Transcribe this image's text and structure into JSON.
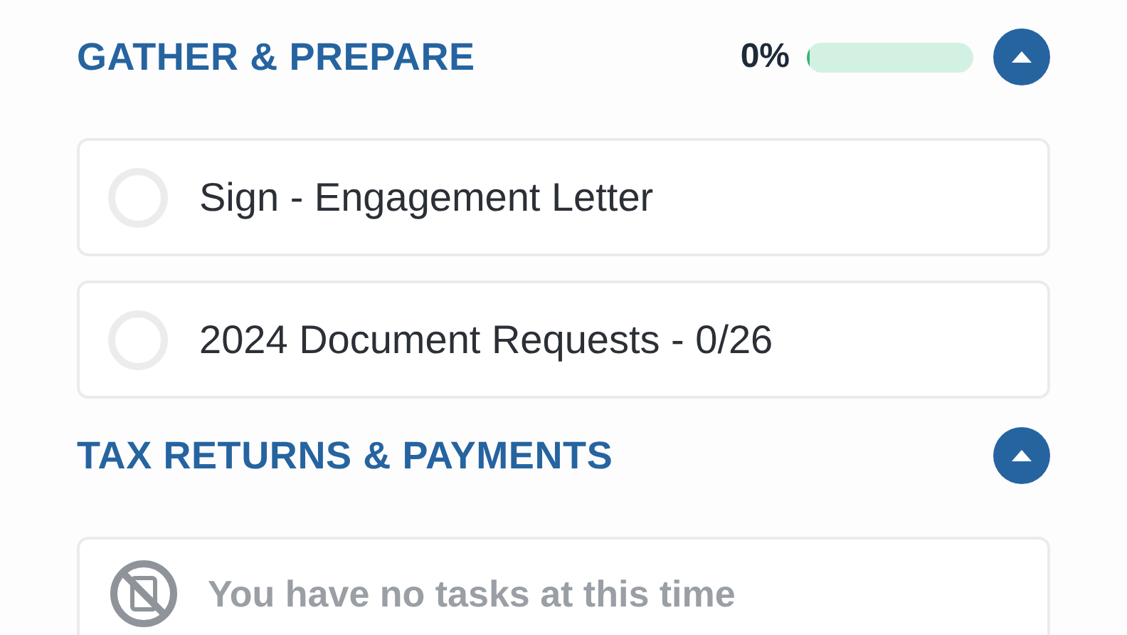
{
  "sections": [
    {
      "title": "GATHER & PREPARE",
      "progress": {
        "reading": "0%",
        "level": 0
      },
      "expanded": true,
      "tasks": [
        {
          "label": "Sign - Engagement Letter",
          "checked": false
        },
        {
          "label": "2024 Document Requests - 0/26",
          "checked": false
        }
      ]
    },
    {
      "title": "TAX RETURNS & PAYMENTS",
      "expanded": true,
      "empty_message": "You have no tasks at this time"
    }
  ]
}
